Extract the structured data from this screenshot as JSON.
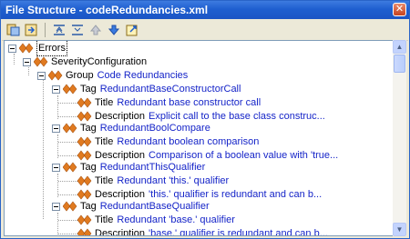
{
  "window": {
    "title": "File Structure - codeRedundancies.xml",
    "close_glyph": "✕"
  },
  "toolbar": {
    "icons": [
      "structure-view-icon",
      "navigate-icon",
      "expand-all-icon",
      "collapse-all-icon",
      "move-up-icon",
      "move-down-icon",
      "export-icon"
    ]
  },
  "tree": {
    "root": "Errors",
    "severity": "SeverityConfiguration",
    "group": {
      "keyword": "Group",
      "value": "Code Redundancies"
    },
    "tags": [
      {
        "keyword": "Tag",
        "value": "RedundantBaseConstructorCall",
        "title_kw": "Title",
        "title": "Redundant base constructor call",
        "desc_kw": "Description",
        "desc": "Explicit call to the base class construc..."
      },
      {
        "keyword": "Tag",
        "value": "RedundantBoolCompare",
        "title_kw": "Title",
        "title": "Redundant boolean comparison",
        "desc_kw": "Description",
        "desc": "Comparison of a boolean value with 'true..."
      },
      {
        "keyword": "Tag",
        "value": "RedundantThisQualifier",
        "title_kw": "Title",
        "title": "Redundant 'this.' qualifier",
        "desc_kw": "Description",
        "desc": "'this.' qualifier is redundant and can b..."
      },
      {
        "keyword": "Tag",
        "value": "RedundantBaseQualifier",
        "title_kw": "Title",
        "title": "Redundant 'base.' qualifier",
        "desc_kw": "Description",
        "desc": "'base.' qualifier is redundant and can b..."
      }
    ]
  },
  "colors": {
    "title_bar": "#1f5fd0",
    "value_text": "#1524c8",
    "node_icon": "#e07a20"
  }
}
